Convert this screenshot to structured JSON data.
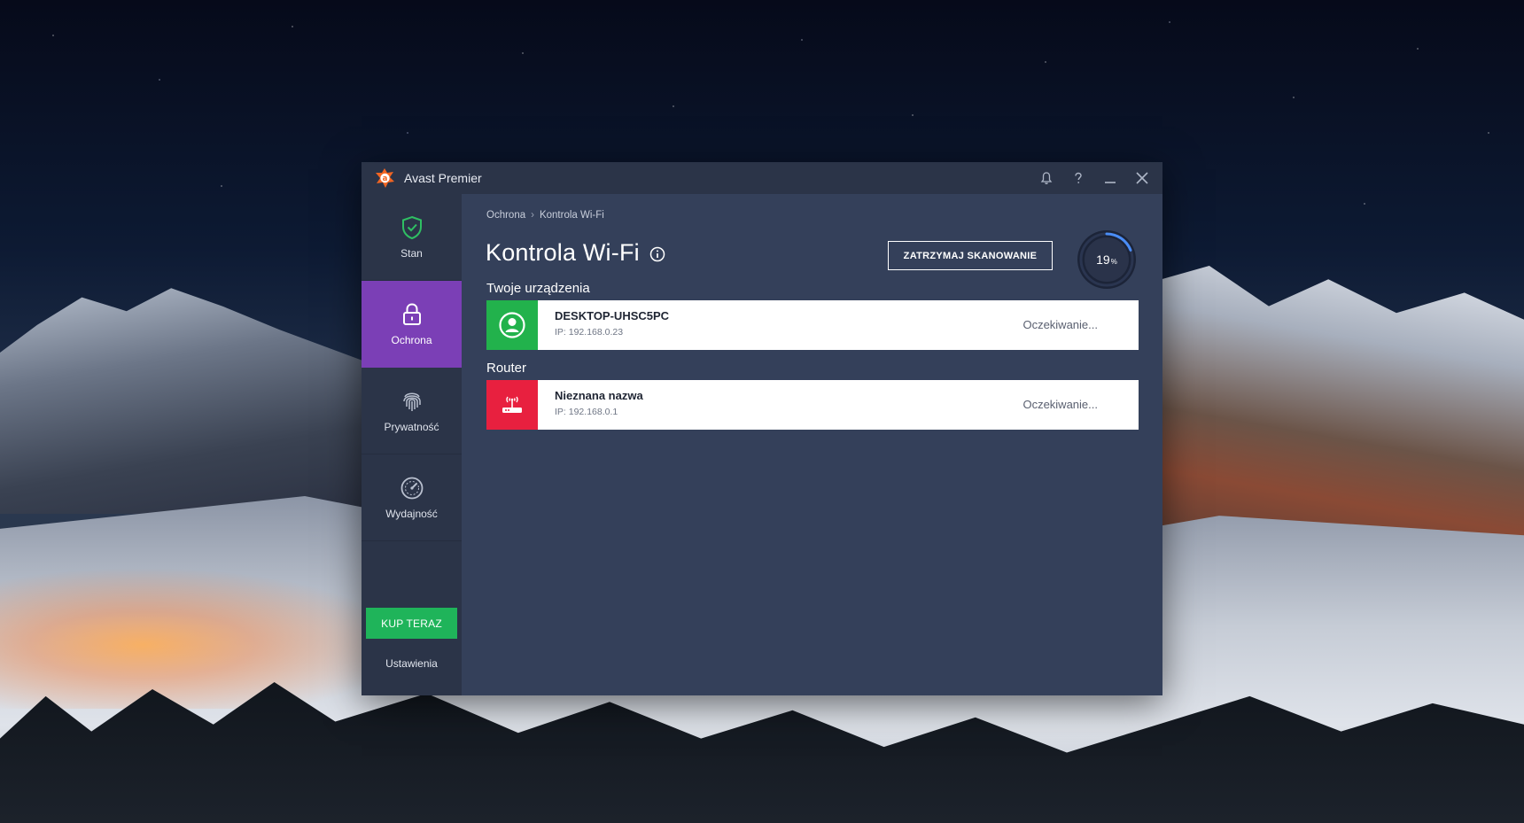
{
  "app": {
    "title": "Avast Premier"
  },
  "sidebar": {
    "items": [
      {
        "label": "Stan",
        "icon": "shield-check-icon",
        "active": false
      },
      {
        "label": "Ochrona",
        "icon": "lock-icon",
        "active": true
      },
      {
        "label": "Prywatność",
        "icon": "fingerprint-icon",
        "active": false
      },
      {
        "label": "Wydajność",
        "icon": "speedometer-icon",
        "active": false
      }
    ],
    "buy_label": "KUP TERAZ",
    "settings_label": "Ustawienia"
  },
  "main": {
    "breadcrumb": [
      "Ochrona",
      "Kontrola Wi-Fi"
    ],
    "breadcrumb_separator": "›",
    "title": "Kontrola Wi-Fi",
    "stop_button_label": "ZATRZYMAJ SKANOWANIE",
    "progress": {
      "value": 19,
      "unit": "%"
    },
    "devices_section_title": "Twoje urządzenia",
    "router_section_title": "Router",
    "devices": [
      {
        "name": "DESKTOP-UHSC5PC",
        "ip": "IP: 192.168.0.23",
        "status": "Oczekiwanie...",
        "icon": "user-icon",
        "color": "#22b24c"
      }
    ],
    "routers": [
      {
        "name": "Nieznana nazwa",
        "ip": "IP: 192.168.0.1",
        "status": "Oczekiwanie...",
        "icon": "router-icon",
        "color": "#e8203f"
      }
    ]
  },
  "colors": {
    "accent_purple": "#7b3fb6",
    "buy_green": "#1fb45a",
    "device_green": "#22b24c",
    "router_red": "#e8203f",
    "logo_orange": "#f26522"
  }
}
